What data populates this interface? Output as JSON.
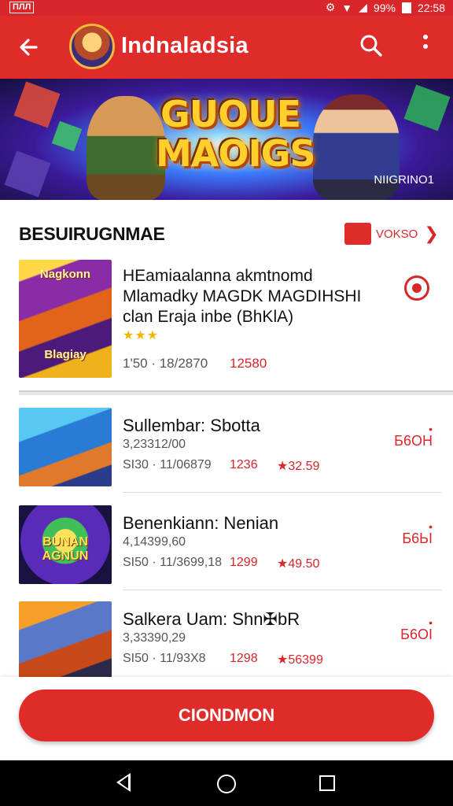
{
  "status_bar": {
    "left_label": "ПЛЛ",
    "battery": "99%",
    "time": "22:58"
  },
  "app_bar": {
    "title": "Indnaladsia"
  },
  "banner": {
    "title_line1": "GUOUE",
    "title_line2": "MAOIGS",
    "tag": "NIIGRINO1"
  },
  "section": {
    "title": "BESUIRUGNMAE",
    "more_label": "VOKSO"
  },
  "featured": {
    "title": "HEamiaalanna akmtnomd Mlamadky MAGDK MAGDIHSHI clan Eraja inbe (BhKlA)",
    "thumb_label": "Nagkonn",
    "thumb_label2": "Blagiay",
    "stars": "★★★",
    "meta": "1'50 · 18/2870",
    "price": "12580"
  },
  "items": [
    {
      "title": "Sullembar: Sbotta",
      "sub": "3,23312/00",
      "meta": "SI30 · 11/06879",
      "price": "1236",
      "rating": "★32.59",
      "action_label": "Б6ОН",
      "thumb_style": "t-blue",
      "thumb_label": ""
    },
    {
      "title": "Benenkiann: Nenian",
      "sub": "4,14399,60",
      "meta": "SI50 · 11/3699,18",
      "price": "1299",
      "rating": "★49.50",
      "action_label": "Б6ЬІ",
      "thumb_style": "t-purple",
      "thumb_label": "BUNAN AGNUN"
    },
    {
      "title": "Salkera Uam: Shn✠bR",
      "sub": "3,33390,29",
      "meta": "SI50 · 11/93X8",
      "price": "1298",
      "rating": "★56399",
      "action_label": "Б6ОІ",
      "thumb_style": "t-orange",
      "thumb_label": ""
    }
  ],
  "cta": {
    "label": "CIONDMON"
  },
  "colors": {
    "primary": "#e02b2b",
    "text": "#111111",
    "muted": "#555555",
    "star": "#f2b705"
  },
  "icons": {
    "back": "arrow-left-icon",
    "search": "search-icon",
    "more": "more-vertical-icon"
  }
}
